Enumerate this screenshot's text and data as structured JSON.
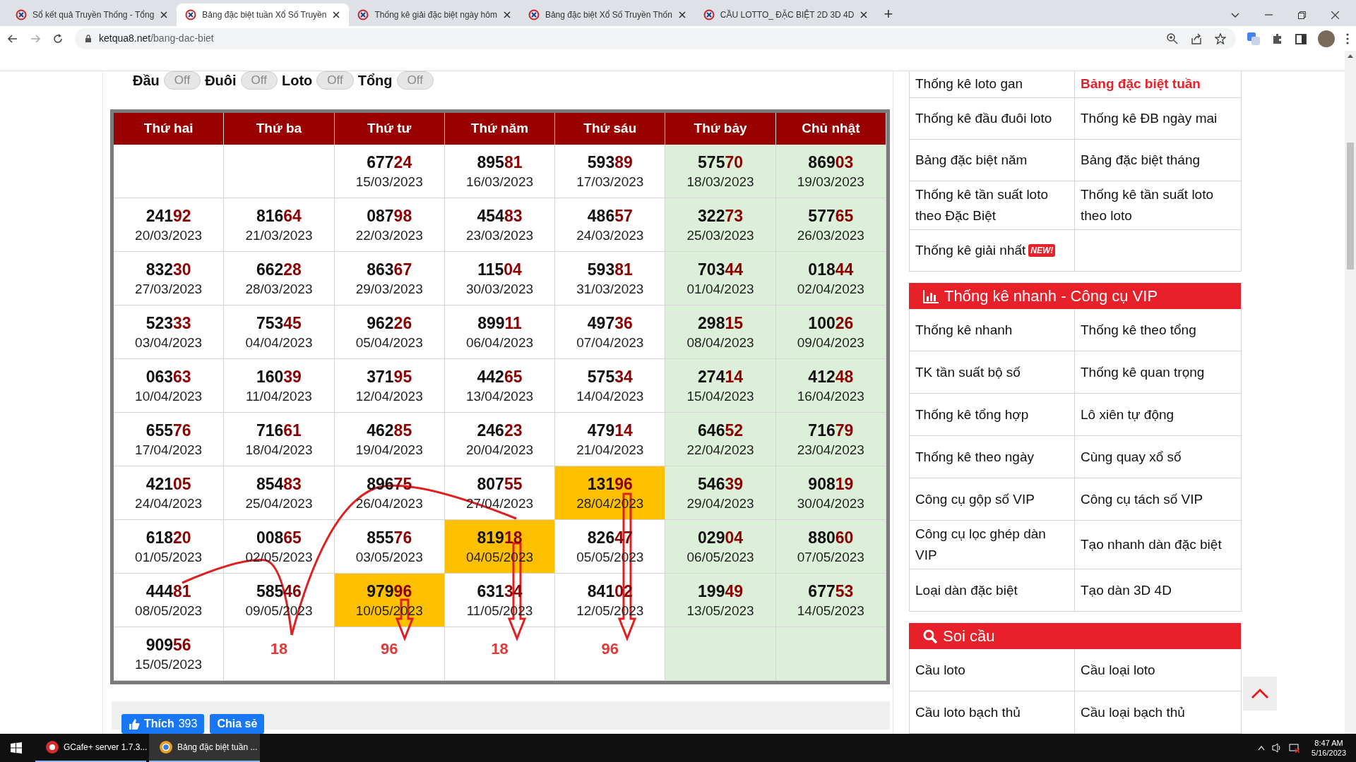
{
  "browser": {
    "tabs": [
      {
        "title": "Sổ kết quả Truyền Thống - Tổng",
        "selected": false
      },
      {
        "title": "Bảng đặc biệt tuần Xổ Số Truyền",
        "selected": true
      },
      {
        "title": "Thống kê giải đặc biệt ngày hôm",
        "selected": false
      },
      {
        "title": "Bảng đặc biệt Xổ Số Truyền Thốn",
        "selected": false
      },
      {
        "title": "CẦU LOTTO_ ĐẶC BIỆT 2D 3D 4D",
        "selected": false
      }
    ],
    "new_tab": "+",
    "url": {
      "host": "ketqua8.net",
      "path": "/bang-dac-biet"
    }
  },
  "filters": [
    {
      "label": "Đầu",
      "toggle": "Off",
      "on": false
    },
    {
      "label": "Đuôi",
      "toggle": "Off",
      "on": false
    },
    {
      "label": "Loto",
      "toggle": "Off",
      "on": false
    },
    {
      "label": "Tổng",
      "toggle": "Off",
      "on": false
    }
  ],
  "table": {
    "columns": [
      {
        "label": "Thứ hai",
        "weekend": false
      },
      {
        "label": "Thứ ba",
        "weekend": false
      },
      {
        "label": "Thứ tư",
        "weekend": false
      },
      {
        "label": "Thứ năm",
        "weekend": false
      },
      {
        "label": "Thứ sáu",
        "weekend": false
      },
      {
        "label": "Thứ bảy",
        "weekend": true
      },
      {
        "label": "Chủ nhật",
        "weekend": true
      }
    ],
    "rows": [
      [
        {
          "kind": "empty"
        },
        {
          "kind": "empty"
        },
        {
          "kind": "result",
          "number": "67724",
          "date": "15/03/2023",
          "highlight": false
        },
        {
          "kind": "result",
          "number": "89581",
          "date": "16/03/2023",
          "highlight": false
        },
        {
          "kind": "result",
          "number": "59389",
          "date": "17/03/2023",
          "highlight": false
        },
        {
          "kind": "result",
          "number": "57570",
          "date": "18/03/2023",
          "highlight": false
        },
        {
          "kind": "result",
          "number": "86903",
          "date": "19/03/2023",
          "highlight": false
        }
      ],
      [
        {
          "kind": "result",
          "number": "24192",
          "date": "20/03/2023",
          "highlight": false
        },
        {
          "kind": "result",
          "number": "81664",
          "date": "21/03/2023",
          "highlight": false
        },
        {
          "kind": "result",
          "number": "08798",
          "date": "22/03/2023",
          "highlight": false
        },
        {
          "kind": "result",
          "number": "45483",
          "date": "23/03/2023",
          "highlight": false
        },
        {
          "kind": "result",
          "number": "48657",
          "date": "24/03/2023",
          "highlight": false
        },
        {
          "kind": "result",
          "number": "32273",
          "date": "25/03/2023",
          "highlight": false
        },
        {
          "kind": "result",
          "number": "57765",
          "date": "26/03/2023",
          "highlight": false
        }
      ],
      [
        {
          "kind": "result",
          "number": "83230",
          "date": "27/03/2023",
          "highlight": false
        },
        {
          "kind": "result",
          "number": "66228",
          "date": "28/03/2023",
          "highlight": false
        },
        {
          "kind": "result",
          "number": "86367",
          "date": "29/03/2023",
          "highlight": false
        },
        {
          "kind": "result",
          "number": "11504",
          "date": "30/03/2023",
          "highlight": false
        },
        {
          "kind": "result",
          "number": "59381",
          "date": "31/03/2023",
          "highlight": false
        },
        {
          "kind": "result",
          "number": "70344",
          "date": "01/04/2023",
          "highlight": false
        },
        {
          "kind": "result",
          "number": "01844",
          "date": "02/04/2023",
          "highlight": false
        }
      ],
      [
        {
          "kind": "result",
          "number": "52333",
          "date": "03/04/2023",
          "highlight": false
        },
        {
          "kind": "result",
          "number": "75345",
          "date": "04/04/2023",
          "highlight": false
        },
        {
          "kind": "result",
          "number": "96226",
          "date": "05/04/2023",
          "highlight": false
        },
        {
          "kind": "result",
          "number": "89911",
          "date": "06/04/2023",
          "highlight": false
        },
        {
          "kind": "result",
          "number": "49736",
          "date": "07/04/2023",
          "highlight": false
        },
        {
          "kind": "result",
          "number": "29815",
          "date": "08/04/2023",
          "highlight": false
        },
        {
          "kind": "result",
          "number": "10026",
          "date": "09/04/2023",
          "highlight": false
        }
      ],
      [
        {
          "kind": "result",
          "number": "06363",
          "date": "10/04/2023",
          "highlight": false
        },
        {
          "kind": "result",
          "number": "16039",
          "date": "11/04/2023",
          "highlight": false
        },
        {
          "kind": "result",
          "number": "37195",
          "date": "12/04/2023",
          "highlight": false
        },
        {
          "kind": "result",
          "number": "44265",
          "date": "13/04/2023",
          "highlight": false
        },
        {
          "kind": "result",
          "number": "57534",
          "date": "14/04/2023",
          "highlight": false
        },
        {
          "kind": "result",
          "number": "27414",
          "date": "15/04/2023",
          "highlight": false
        },
        {
          "kind": "result",
          "number": "41248",
          "date": "16/04/2023",
          "highlight": false
        }
      ],
      [
        {
          "kind": "result",
          "number": "65576",
          "date": "17/04/2023",
          "highlight": false
        },
        {
          "kind": "result",
          "number": "71661",
          "date": "18/04/2023",
          "highlight": false
        },
        {
          "kind": "result",
          "number": "46285",
          "date": "19/04/2023",
          "highlight": false
        },
        {
          "kind": "result",
          "number": "24623",
          "date": "20/04/2023",
          "highlight": false
        },
        {
          "kind": "result",
          "number": "47914",
          "date": "21/04/2023",
          "highlight": false
        },
        {
          "kind": "result",
          "number": "64652",
          "date": "22/04/2023",
          "highlight": false
        },
        {
          "kind": "result",
          "number": "71679",
          "date": "23/04/2023",
          "highlight": false
        }
      ],
      [
        {
          "kind": "result",
          "number": "42105",
          "date": "24/04/2023",
          "highlight": false
        },
        {
          "kind": "result",
          "number": "85483",
          "date": "25/04/2023",
          "highlight": false
        },
        {
          "kind": "result",
          "number": "89675",
          "date": "26/04/2023",
          "highlight": false
        },
        {
          "kind": "result",
          "number": "80755",
          "date": "27/04/2023",
          "highlight": false
        },
        {
          "kind": "result",
          "number": "13196",
          "date": "28/04/2023",
          "highlight": true
        },
        {
          "kind": "result",
          "number": "54639",
          "date": "29/04/2023",
          "highlight": false
        },
        {
          "kind": "result",
          "number": "90819",
          "date": "30/04/2023",
          "highlight": false
        }
      ],
      [
        {
          "kind": "result",
          "number": "61820",
          "date": "01/05/2023",
          "highlight": false
        },
        {
          "kind": "result",
          "number": "00865",
          "date": "02/05/2023",
          "highlight": false
        },
        {
          "kind": "result",
          "number": "85576",
          "date": "03/05/2023",
          "highlight": false
        },
        {
          "kind": "result",
          "number": "81918",
          "date": "04/05/2023",
          "highlight": true
        },
        {
          "kind": "result",
          "number": "82647",
          "date": "05/05/2023",
          "highlight": false
        },
        {
          "kind": "result",
          "number": "02904",
          "date": "06/05/2023",
          "highlight": false
        },
        {
          "kind": "result",
          "number": "88060",
          "date": "07/05/2023",
          "highlight": false
        }
      ],
      [
        {
          "kind": "result",
          "number": "44481",
          "date": "08/05/2023",
          "highlight": false
        },
        {
          "kind": "result",
          "number": "58546",
          "date": "09/05/2023",
          "highlight": false
        },
        {
          "kind": "result",
          "number": "97996",
          "date": "10/05/2023",
          "highlight": true
        },
        {
          "kind": "result",
          "number": "63134",
          "date": "11/05/2023",
          "highlight": false
        },
        {
          "kind": "result",
          "number": "84102",
          "date": "12/05/2023",
          "highlight": false
        },
        {
          "kind": "result",
          "number": "19949",
          "date": "13/05/2023",
          "highlight": false
        },
        {
          "kind": "result",
          "number": "67753",
          "date": "14/05/2023",
          "highlight": false
        }
      ],
      [
        {
          "kind": "result",
          "number": "90956",
          "date": "15/05/2023",
          "highlight": false
        },
        {
          "kind": "note",
          "text": "18"
        },
        {
          "kind": "note",
          "text": "96"
        },
        {
          "kind": "note",
          "text": "18"
        },
        {
          "kind": "note",
          "text": "96"
        },
        {
          "kind": "empty"
        },
        {
          "kind": "empty"
        }
      ]
    ]
  },
  "social": {
    "like_label": "Thích",
    "like_count": "393",
    "share": "Chia sẻ"
  },
  "sidebar": {
    "links": [
      {
        "text": "Thống kê loto gan",
        "selected": false
      },
      {
        "text": "Bảng đặc biệt tuần",
        "selected": true
      },
      {
        "text": "Thống kê đầu đuôi loto",
        "selected": false
      },
      {
        "text": "Thống kê ĐB ngày mai",
        "selected": false
      },
      {
        "text": "Bảng đặc biệt năm",
        "selected": false
      },
      {
        "text": "Bảng đặc biệt tháng",
        "selected": false
      },
      {
        "text": "Thống kê tần suất loto theo Đặc Biệt",
        "selected": false
      },
      {
        "text": "Thống kê tần suất loto theo loto",
        "selected": false
      },
      {
        "text": "Thống kê giải nhất",
        "selected": false,
        "badge": "NEW!"
      }
    ],
    "sections": [
      {
        "title": "Thống kê nhanh - Công cụ VIP",
        "links": [
          "Thống kê nhanh",
          "Thống kê theo tổng",
          "TK tần suất bộ số",
          "Thống kê quan trọng",
          "Thống kê tổng hợp",
          "Lô xiên tự động",
          "Thống kê theo ngày",
          "Cùng quay xổ số",
          "Công cụ gộp số VIP",
          "Công cụ tách số VIP",
          "Công cụ lọc ghép dàn VIP",
          "Tạo nhanh dàn đặc biệt",
          "Loại dàn đặc biệt",
          "Tạo dàn 3D 4D"
        ]
      },
      {
        "title": "Soi cầu",
        "links": [
          "Cầu loto",
          "Cầu loại loto",
          "Cầu loto bạch thủ",
          "Cầu loại bạch thủ"
        ]
      }
    ]
  },
  "taskbar": {
    "apps": [
      {
        "label": "GCafe+ server 1.7.3...",
        "selected": false
      },
      {
        "label": "Bảng đặc biệt tuần ...",
        "selected": true
      }
    ],
    "time": "8:47 AM",
    "date": "5/16/2023"
  }
}
